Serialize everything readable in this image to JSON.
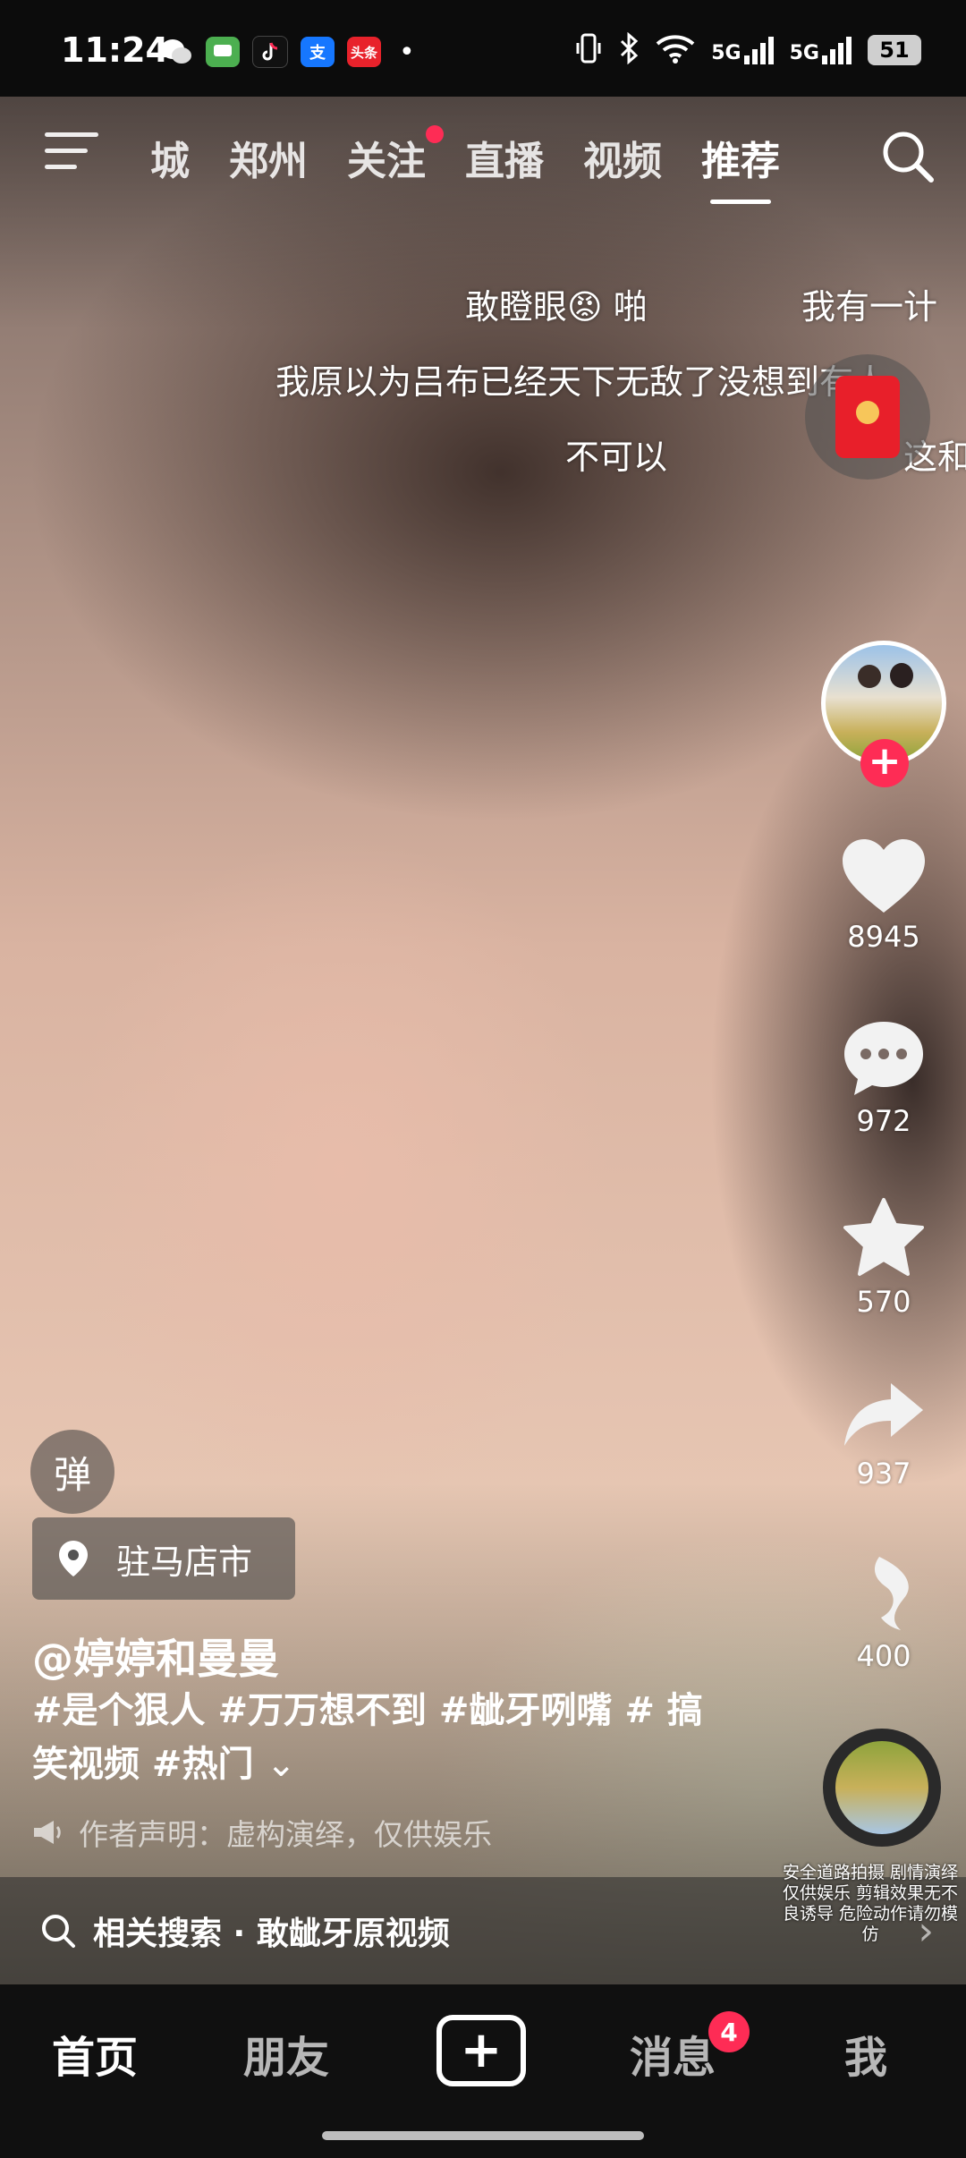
{
  "status_bar": {
    "time": "11:24",
    "apps": [
      "wechat-icon",
      "messages-icon",
      "tiktok-icon",
      "alipay-icon",
      "toutiao-icon"
    ],
    "app_labels": {
      "alipay": "支",
      "toutiao": "头条"
    },
    "more_dot": "•",
    "signal_1": "5G",
    "signal_2": "5G",
    "battery": "51"
  },
  "top_nav": {
    "tabs": [
      "城",
      "郑州",
      "关注",
      "直播",
      "视频",
      "推荐"
    ],
    "active_tab": "推荐"
  },
  "danmaku": [
    "敢瞪眼😡 啪",
    "我有一计",
    "我原以为吕布已经天下无敌了没想到有人",
    "不可以",
    "这和"
  ],
  "right_rail": {
    "likes": "8945",
    "comments": "972",
    "favorites": "570",
    "shares": "937",
    "recommend": "400",
    "follow_symbol": "+",
    "music_text": "安全道路拍摄 剧情演绎仅供娱乐 剪辑效果无不良诱导 危险动作请勿模仿"
  },
  "video_info": {
    "danmaku_toggle": "弹",
    "location": "驻马店市",
    "author": "@婷婷和曼曼",
    "description": "#是个狠人 #万万想不到 #龇牙咧嘴 # 搞笑视频 #热门",
    "expand_symbol": "⌄",
    "notice": "作者声明：虚构演绎，仅供娱乐"
  },
  "related_search": {
    "text": "相关搜索 · 敢龇牙原视频",
    "arrow": "›"
  },
  "bottom_nav": {
    "home": "首页",
    "friends": "朋友",
    "add": "+",
    "messages": "消息",
    "messages_badge": "4",
    "me": "我"
  },
  "colors": {
    "accent": "#fe2c55",
    "nav_bg": "#101010"
  }
}
